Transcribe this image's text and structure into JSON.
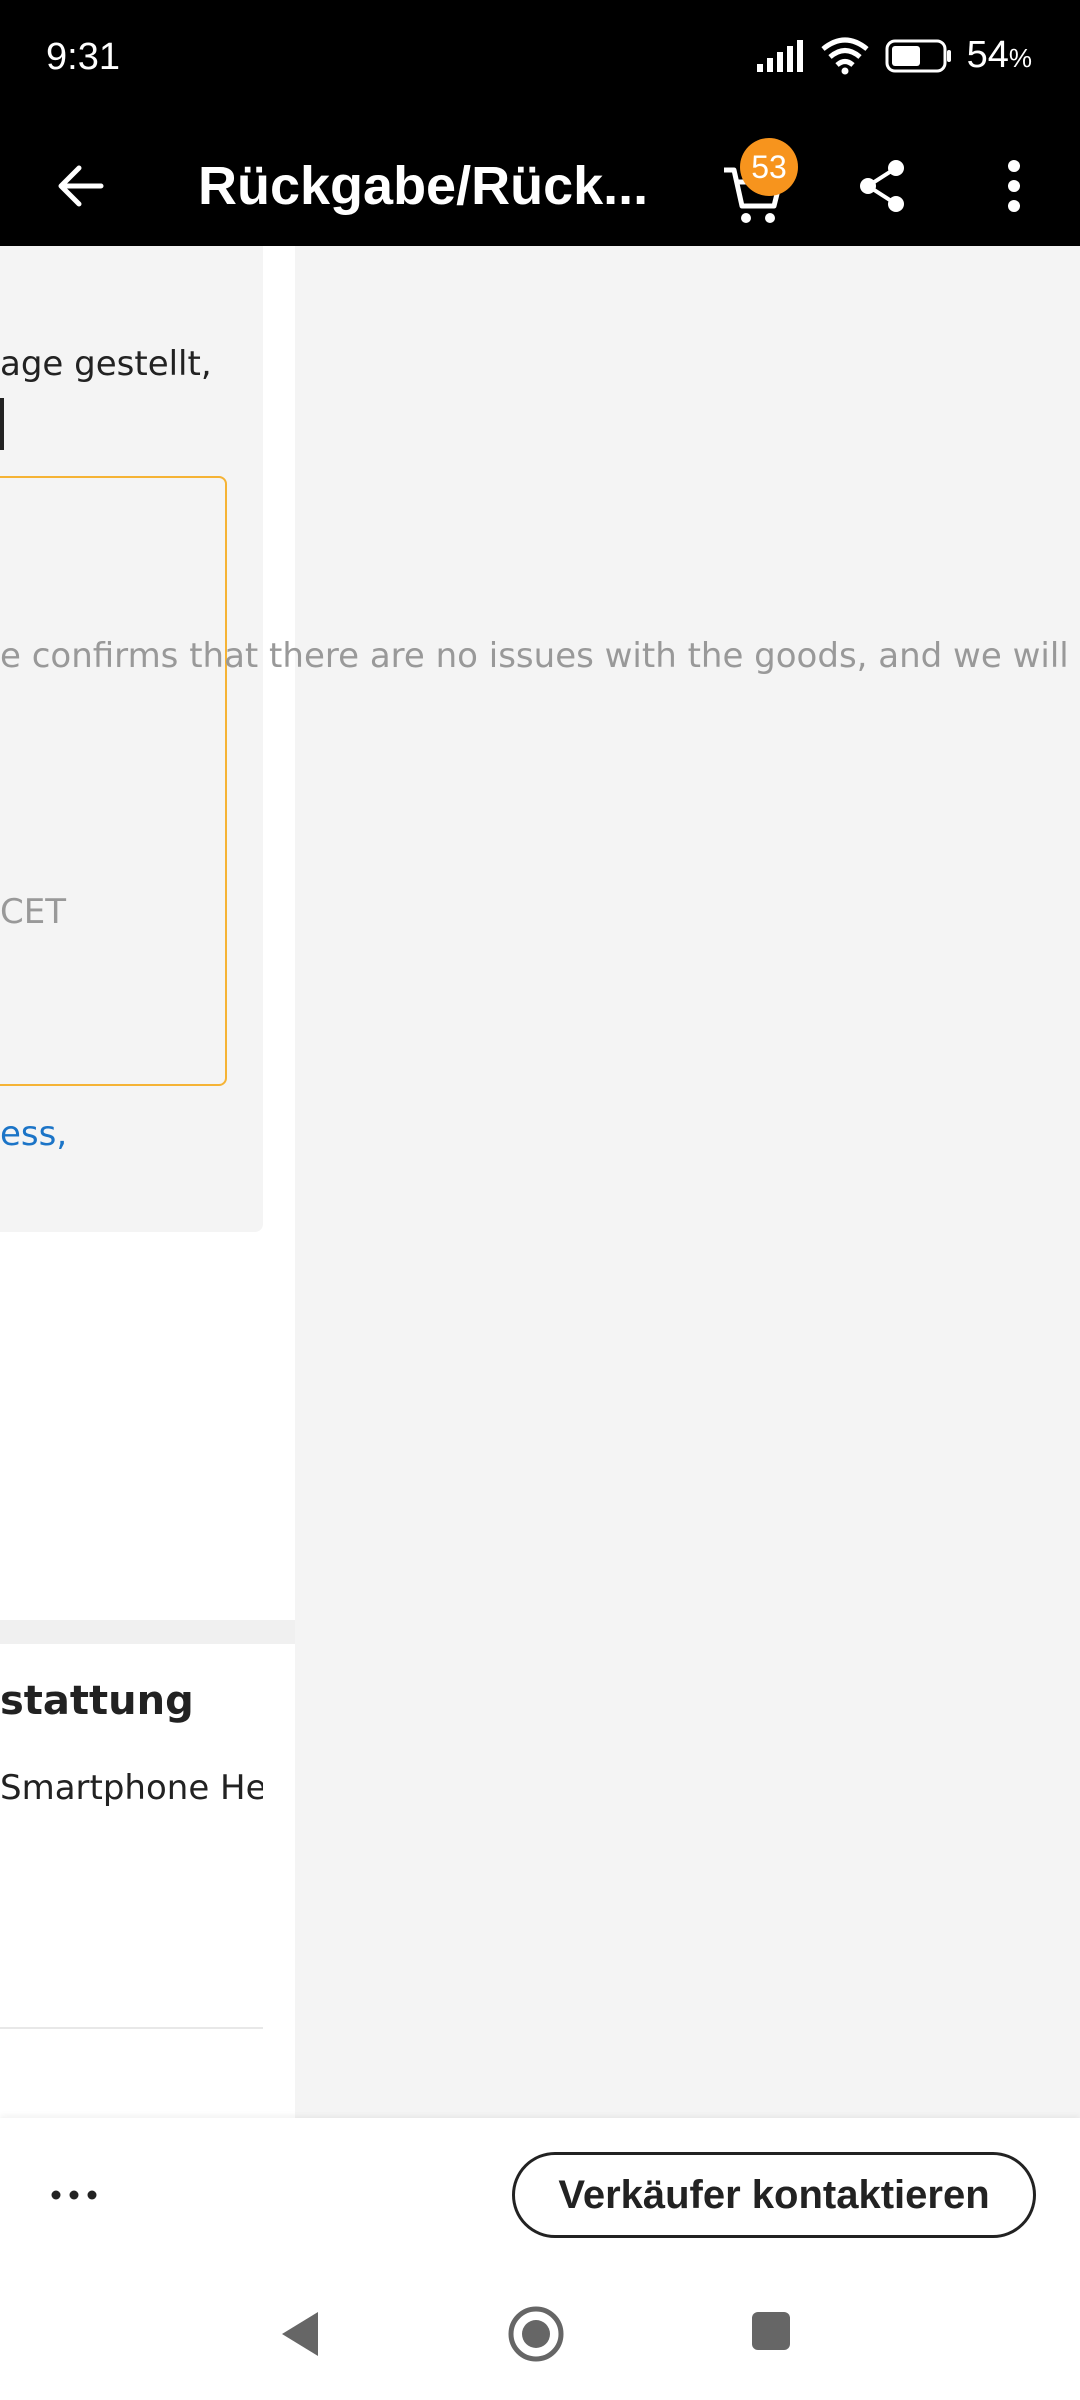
{
  "status_bar": {
    "time": "9:31",
    "battery_percent": "54",
    "battery_unit": "%"
  },
  "app_bar": {
    "title": "Rückgabe/Rück...",
    "cart_count": "53",
    "back_icon": "arrow-left-icon",
    "share_icon": "share-icon",
    "more_icon": "more-vertical-icon"
  },
  "main": {
    "request_text": "age gestellt,",
    "notice_text": "e confirms that there are no issues with the goods, and we will refund y",
    "deadline_text": "CET",
    "address_link": "ess,"
  },
  "refund_section": {
    "title": "stattung",
    "product_name": "Smartphone Hel..."
  },
  "bottom_bar": {
    "more_label": "...",
    "contact_button": "Verkäufer kontaktieren"
  },
  "colors": {
    "accent": "#f7941d",
    "box_border": "#f5b335",
    "link": "#1b74c7"
  }
}
